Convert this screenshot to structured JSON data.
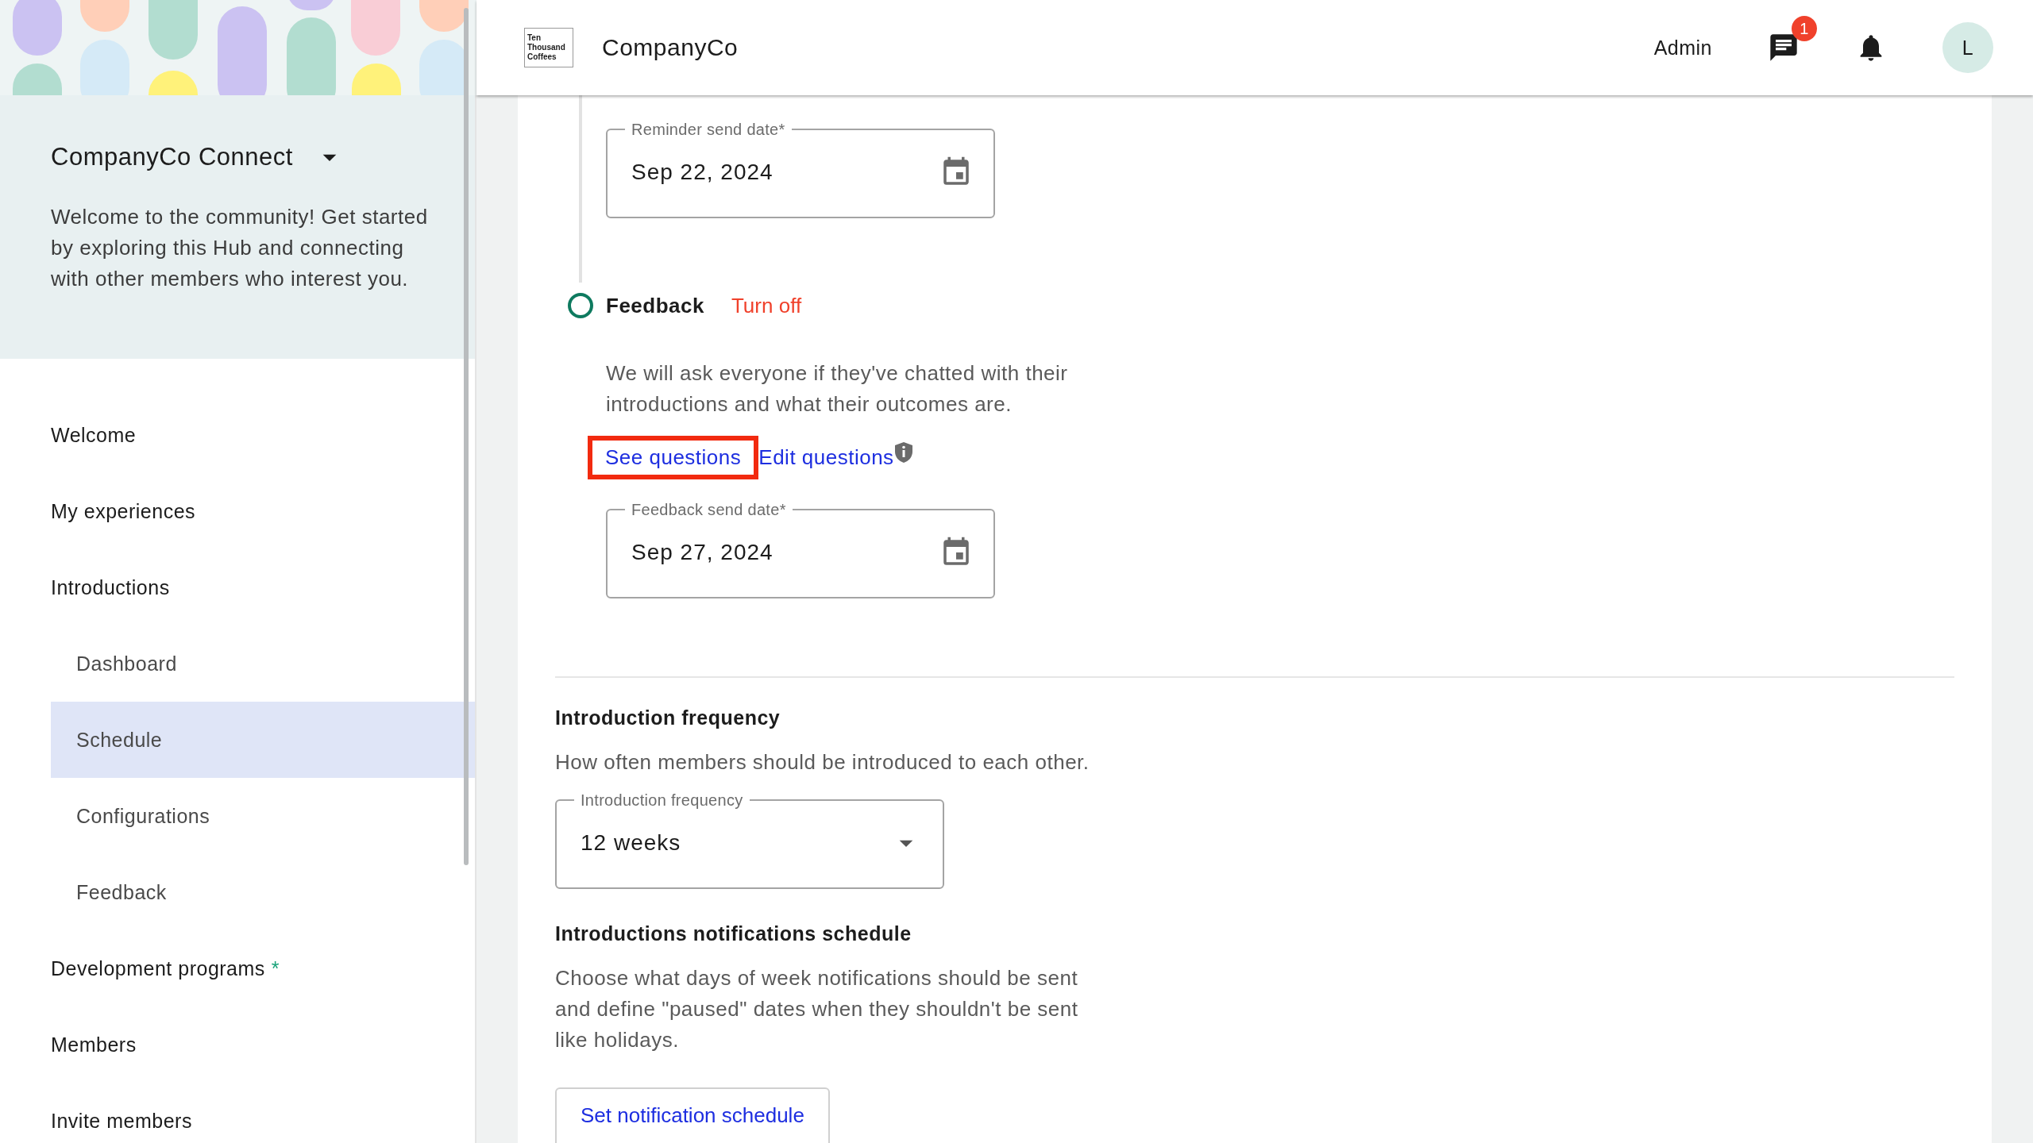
{
  "header": {
    "logo_lines": [
      "Ten",
      "Thousand",
      "Coffees"
    ],
    "brand": "CompanyCo",
    "role": "Admin",
    "messages_badge": "1",
    "avatar": "L"
  },
  "sidebar": {
    "hub_title": "CompanyCo Connect",
    "welcome": "Welcome to the community! Get started by exploring this Hub and connecting with other members who interest you.",
    "items": [
      {
        "label": "Welcome",
        "selected": false
      },
      {
        "label": "My experiences",
        "selected": false
      },
      {
        "label": "Introductions",
        "selected": false,
        "children": [
          {
            "label": "Dashboard",
            "selected": false
          },
          {
            "label": "Schedule",
            "selected": true
          },
          {
            "label": "Configurations",
            "selected": false
          },
          {
            "label": "Feedback",
            "selected": false
          }
        ]
      },
      {
        "label": "Development programs",
        "selected": false,
        "marker": "*"
      },
      {
        "label": "Members",
        "selected": false
      },
      {
        "label": "Invite members",
        "selected": false
      }
    ]
  },
  "main": {
    "reminder_field": {
      "label": "Reminder send date*",
      "value": "Sep 22, 2024"
    },
    "step": {
      "title": "Feedback",
      "action": "Turn off",
      "description": "We will ask everyone if they've chatted with their introductions and what their outcomes are.",
      "links": [
        {
          "label": "See questions",
          "highlighted": true
        },
        {
          "label": "Edit questions",
          "highlighted": false
        }
      ],
      "field": {
        "label": "Feedback send date*",
        "value": "Sep 27, 2024"
      }
    },
    "frequency": {
      "heading": "Introduction frequency",
      "description": "How often members should be introduced to each other.",
      "select": {
        "label": "Introduction frequency",
        "value": "12 weeks"
      }
    },
    "notifications": {
      "heading": "Introductions notifications schedule",
      "description": "Choose what days of week notifications should be sent and define \"paused\" dates when they shouldn't be sent like holidays.",
      "button": "Set notification schedule"
    }
  }
}
